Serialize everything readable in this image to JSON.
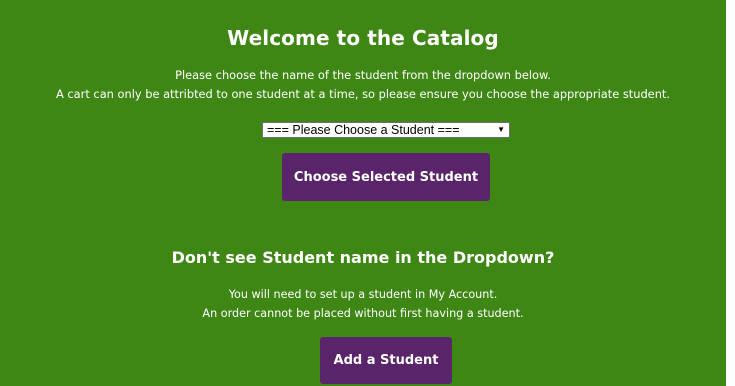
{
  "catalog": {
    "title": "Welcome to the Catalog",
    "intro_line1": "Please choose the name of the student from the dropdown below.",
    "intro_line2": "A cart can only be attribted to one student at a time, so please ensure you choose the appropriate student.",
    "student_select": {
      "selected": "=== Please Choose a Student ===",
      "arrow_icon": "triangle-down-icon"
    },
    "choose_button_label": "Choose Selected Student"
  },
  "missing_student": {
    "heading": "Don't see Student name in the Dropdown?",
    "note_line1": "You will need to set up a student in My Account.",
    "note_line2": "An order cannot be placed without first having a student.",
    "add_button_label": "Add a Student"
  },
  "colors": {
    "panel_background": "#3f8715",
    "button_background": "#59246a",
    "text": "#ffffff"
  }
}
